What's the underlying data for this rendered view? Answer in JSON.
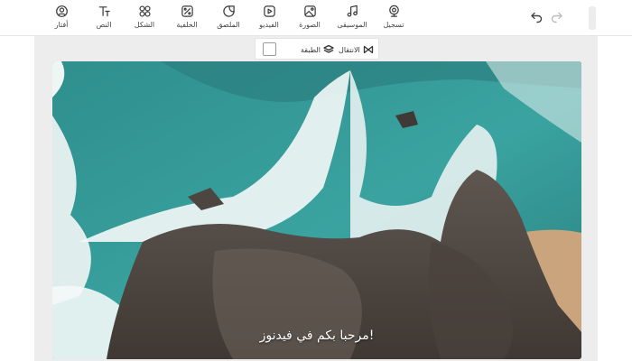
{
  "toolbar": {
    "tools": [
      {
        "label": "تسجيل",
        "icon": "record-icon"
      },
      {
        "label": "الموسيقى",
        "icon": "music-icon"
      },
      {
        "label": "الصورة",
        "icon": "image-icon"
      },
      {
        "label": "الفيديو",
        "icon": "video-icon"
      },
      {
        "label": "الملصق",
        "icon": "sticker-icon"
      },
      {
        "label": "الخلفية",
        "icon": "background-icon"
      },
      {
        "label": "الشكل",
        "icon": "shape-icon"
      },
      {
        "label": "النص",
        "icon": "text-icon"
      },
      {
        "label": "أفتار",
        "icon": "avatar-icon"
      }
    ],
    "undo_icon": "undo-icon",
    "redo_icon": "redo-icon"
  },
  "subbar": {
    "transition_label": "الانتقال",
    "layer_label": "الطبقة",
    "color_value": "#ffffff"
  },
  "video": {
    "caption": "مرحبا بكم في فيدنوز!"
  },
  "colors": {
    "workspace_bg": "#ededed",
    "icon_stroke": "#3a3a3a",
    "redo_disabled": "#bdbdbd"
  }
}
